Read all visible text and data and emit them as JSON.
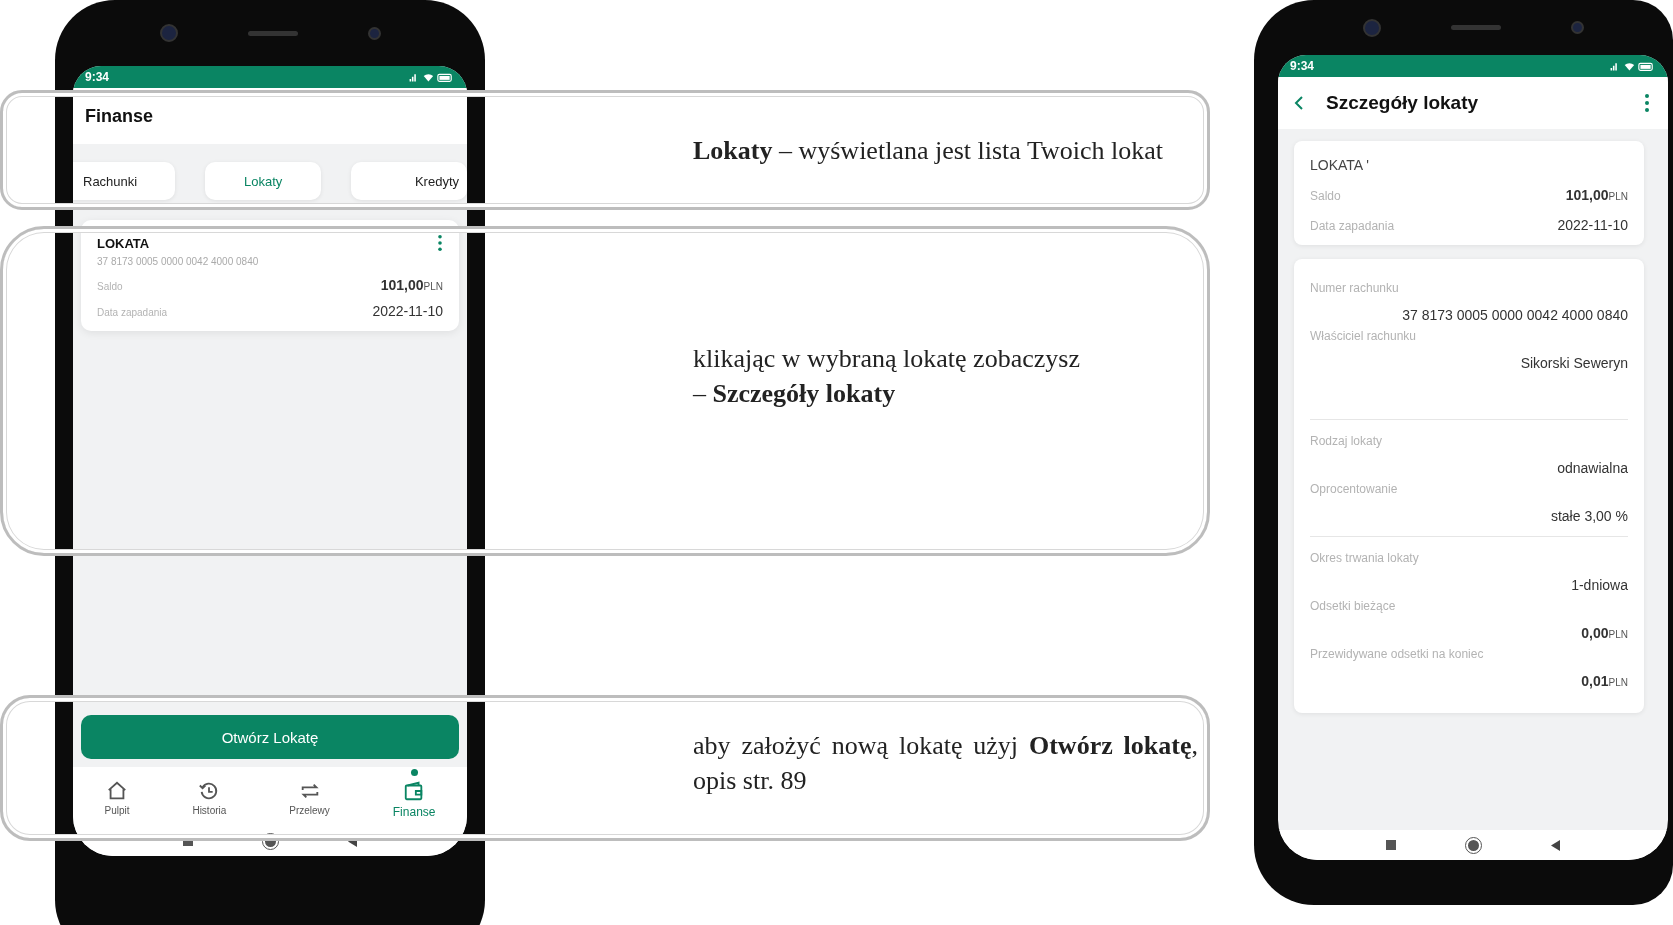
{
  "left_phone": {
    "status_time": "9:34",
    "title": "Finanse",
    "tabs": [
      {
        "label": "Rachunki",
        "selected": false
      },
      {
        "label": "Lokaty",
        "selected": true
      },
      {
        "label": "Kredyty",
        "selected": false
      }
    ],
    "deposit_card": {
      "name": "LOKATA",
      "account": "37 8173 0005 0000 0042 4000 0840",
      "rows": [
        {
          "label": "Saldo",
          "value": "101,00",
          "currency": "PLN"
        },
        {
          "label": "Data zapadania",
          "value": "2022-11-10"
        }
      ]
    },
    "primary_button": "Otwórz Lokatę",
    "bottom_nav": [
      {
        "label": "Pulpit",
        "kind": "home",
        "selected": false
      },
      {
        "label": "Historia",
        "kind": "history",
        "selected": false
      },
      {
        "label": "Przelewy",
        "kind": "transfer",
        "selected": false
      },
      {
        "label": "Finanse",
        "kind": "wallet",
        "selected": true
      }
    ]
  },
  "annotations": [
    {
      "lines": [
        "**Lokaty** – wyświetlana jest lista Twoich lokat"
      ]
    },
    {
      "lines": [
        "klikając w wybraną lokatę zobaczysz",
        "– **Szczegóły lokaty**"
      ]
    },
    {
      "lines": [
        "aby założyć nową lokatę użyj **Otwórz lokatę**, opis str. 89"
      ]
    }
  ],
  "right_phone": {
    "status_time": "9:34",
    "title": "Szczegóły lokaty",
    "summary_card": {
      "name": "LOKATA '",
      "rows": [
        {
          "label": "Saldo",
          "value": "101,00",
          "currency": "PLN"
        },
        {
          "label": "Data zapadania",
          "value": "2022-11-10"
        }
      ]
    },
    "detail_groups": [
      [
        {
          "label": "Numer rachunku",
          "value": "37 8173 0005 0000 0042 4000 0840"
        },
        {
          "label": "Właściciel rachunku",
          "value": "Sikorski Seweryn"
        }
      ],
      [
        {
          "label": "Rodzaj lokaty",
          "value": "odnawialna"
        },
        {
          "label": "Oprocentowanie",
          "value": "stałe 3,00 %"
        }
      ],
      [
        {
          "label": "Okres trwania lokaty",
          "value": "1-dniowa"
        },
        {
          "label": "Odsetki bieżące",
          "value": "0,00",
          "currency": "PLN"
        },
        {
          "label": "Przewidywane odsetki na koniec",
          "value": "0,01",
          "currency": "PLN"
        }
      ]
    ]
  }
}
